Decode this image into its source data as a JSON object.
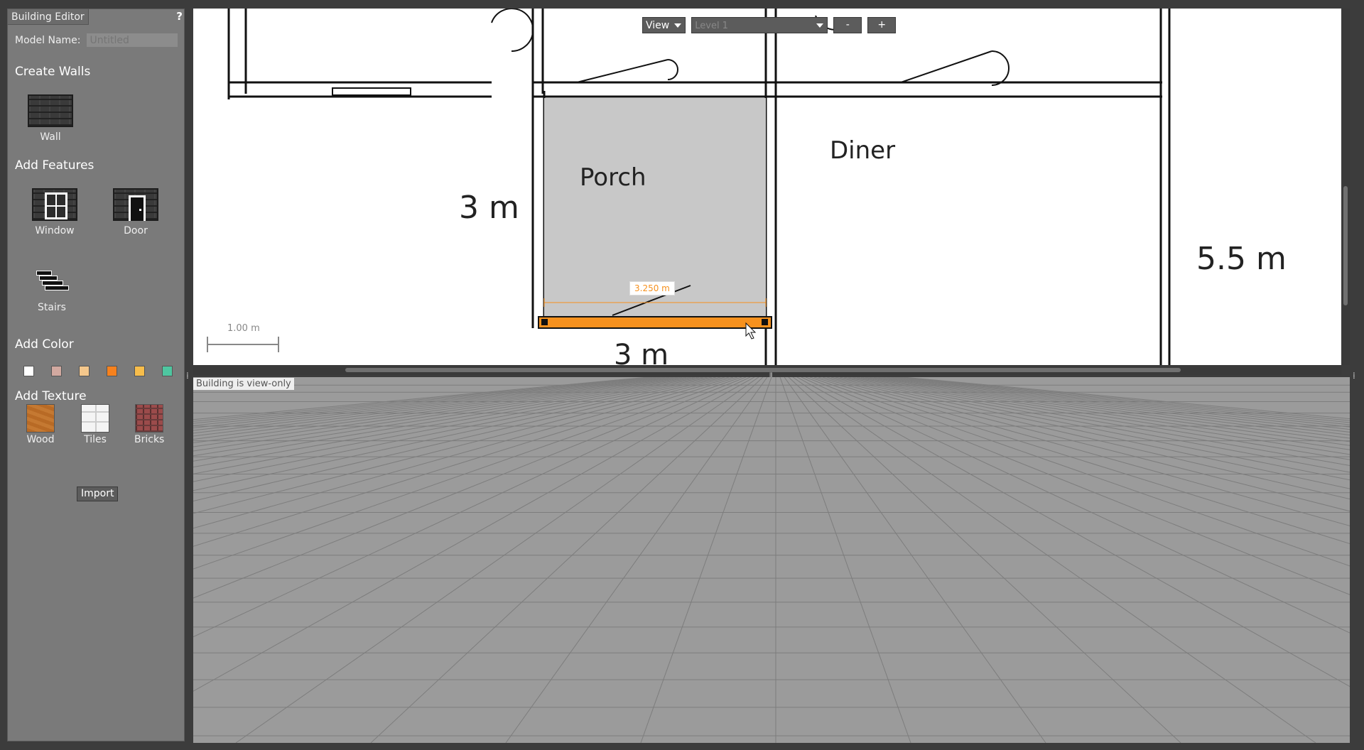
{
  "palette": {
    "tab_title": "Building Editor",
    "help": "?",
    "model_name_label": "Model Name:",
    "model_name_placeholder": "Untitled",
    "create_walls": "Create Walls",
    "wall_label": "Wall",
    "add_features": "Add Features",
    "window_label": "Window",
    "door_label": "Door",
    "stairs_label": "Stairs",
    "add_color": "Add Color",
    "colors": [
      "#ffffff",
      "#d2a9a0",
      "#f4c78c",
      "#f6811d",
      "#f7bd4b",
      "#4ec6a0"
    ],
    "add_texture": "Add Texture",
    "wood_label": "Wood",
    "tiles_label": "Tiles",
    "bricks_label": "Bricks",
    "import_label": "Import"
  },
  "toolbar": {
    "view_label": "View",
    "level_label": "Level 1",
    "zoom_out": "-",
    "zoom_in": "+"
  },
  "plan": {
    "porch_label": "Porch",
    "diner_label": "Diner",
    "dim_left": "3 m",
    "dim_right": "5.5 m",
    "dim_bottom": "3 m",
    "wall_length": "3.250 m",
    "scale_label": "1.00 m",
    "highlight_color": "#f6911e"
  },
  "scene": {
    "status": "Building is view-only"
  }
}
